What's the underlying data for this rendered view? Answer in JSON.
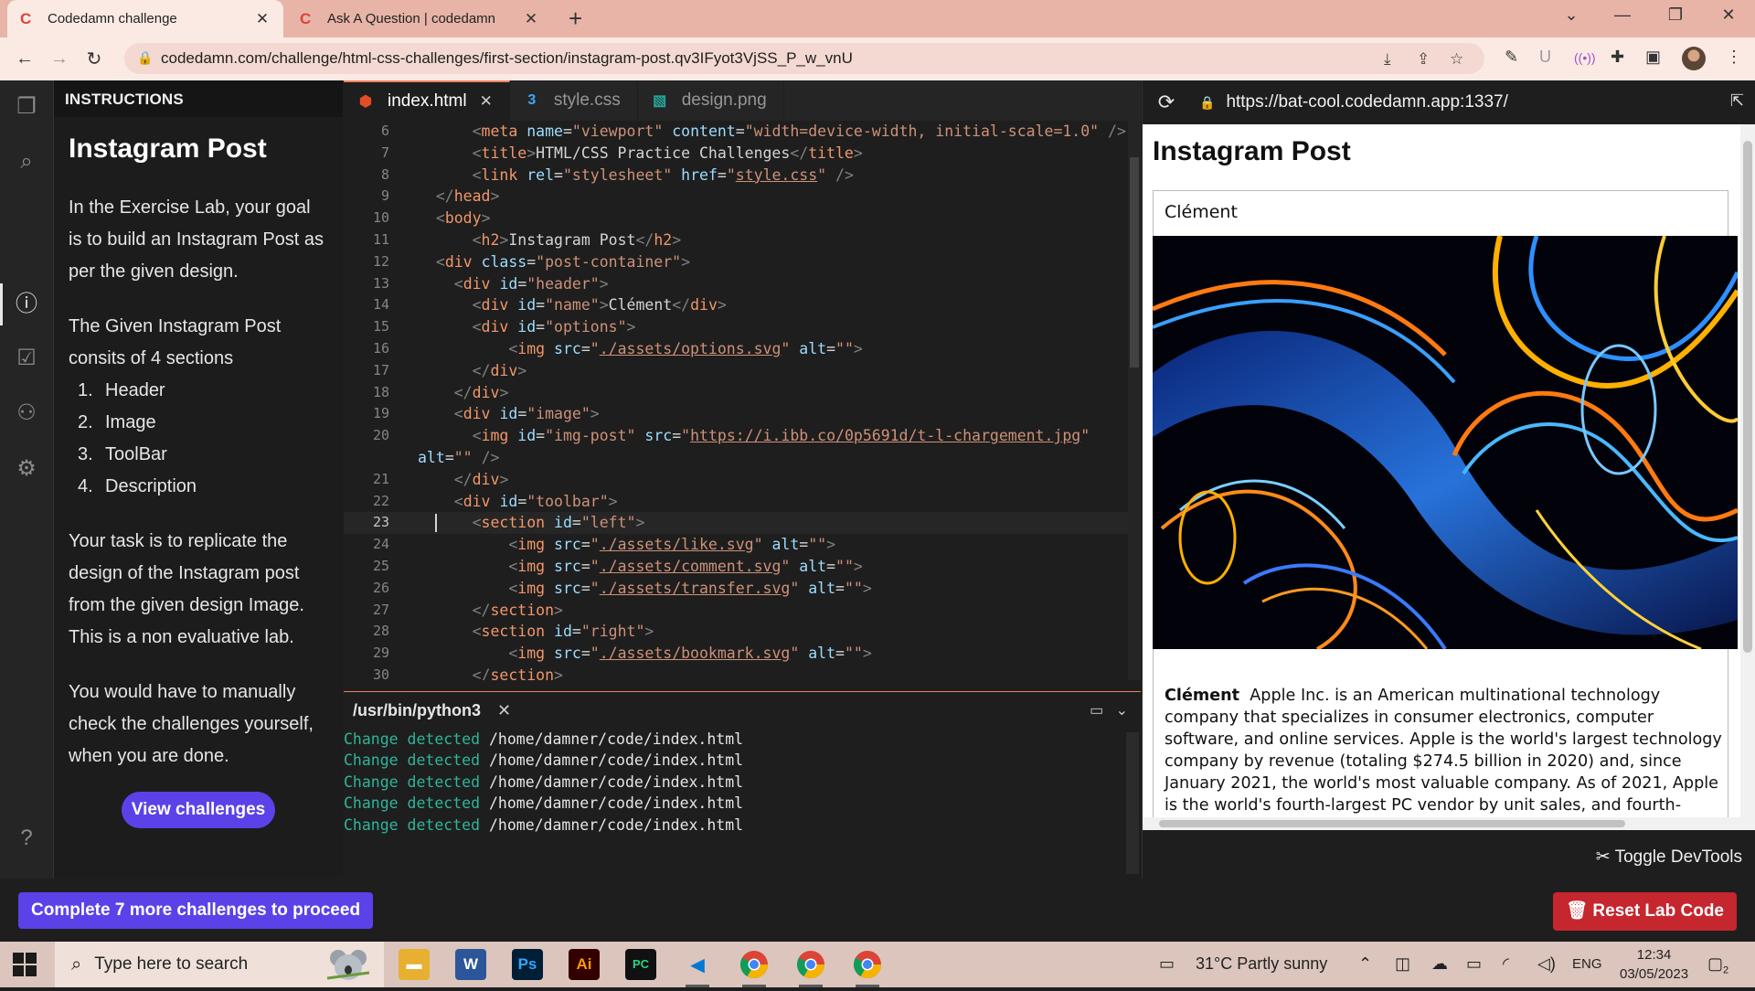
{
  "browser": {
    "tabs": [
      {
        "label": "Codedamn challenge",
        "favicon": "C"
      },
      {
        "label": "Ask A Question | codedamn",
        "favicon": "C"
      }
    ],
    "url": "codedamn.com/challenge/html-css-challenges/first-section/instagram-post.qv3IFyot3VjSS_P_w_vnU"
  },
  "instructions": {
    "header": "INSTRUCTIONS",
    "title": "Instagram Post",
    "para1": "In the Exercise Lab, your goal is to build an Instagram Post as per the given design.",
    "para2": "The Given Instagram Post consits of 4 sections",
    "sections": [
      {
        "num": "1.",
        "label": "Header"
      },
      {
        "num": "2.",
        "label": "Image"
      },
      {
        "num": "3.",
        "label": "ToolBar"
      },
      {
        "num": "4.",
        "label": "Description"
      }
    ],
    "para3": "Your task is to replicate the design of the Instagram post from the given design Image. This is a non evaluative lab.",
    "para4": "You would have to manually check the challenges yourself, when you are done.",
    "view_button": "View challenges"
  },
  "editor": {
    "tabs": [
      {
        "label": "index.html",
        "icon": "html5-icon",
        "active": true
      },
      {
        "label": "style.css",
        "icon": "css3-icon",
        "active": false
      },
      {
        "label": "design.png",
        "icon": "image-file-icon",
        "active": false
      }
    ],
    "current_line": 23
  },
  "terminal": {
    "title": "/usr/bin/python3",
    "lines": [
      {
        "status": "Change detected",
        "path": "/home/damner/code/index.html"
      },
      {
        "status": "Change detected",
        "path": "/home/damner/code/index.html"
      },
      {
        "status": "Change detected",
        "path": "/home/damner/code/index.html"
      },
      {
        "status": "Change detected",
        "path": "/home/damner/code/index.html"
      },
      {
        "status": "Change detected",
        "path": "/home/damner/code/index.html"
      }
    ]
  },
  "preview": {
    "url": "https://bat-cool.codedamn.app:1337/",
    "page_heading": "Instagram Post",
    "post_name": "Clément",
    "desc_name": "Clément",
    "desc_text": "Apple Inc. is an American multinational technology company that specializes in consumer electronics, computer software, and online services. Apple is the world's largest technology company by revenue (totaling $274.5 billion in 2020) and, since January 2021, the world's most valuable company. As of 2021, Apple is the world's fourth-largest PC vendor by unit sales, and fourth-largest smartphone manufacturer.",
    "devtools_label": "Toggle DevTools"
  },
  "footer": {
    "proceed_label": "Complete 7 more challenges to proceed",
    "reset_label": "Reset Lab Code"
  },
  "taskbar": {
    "search_placeholder": "Type here to search",
    "weather": "31°C  Partly sunny",
    "language": "ENG",
    "time": "12:34",
    "date": "03/05/2023",
    "notification_count": "2"
  },
  "colors": {
    "accent": "#5b42e8",
    "danger": "#c6262e",
    "terminal_green": "#2fb59a"
  }
}
